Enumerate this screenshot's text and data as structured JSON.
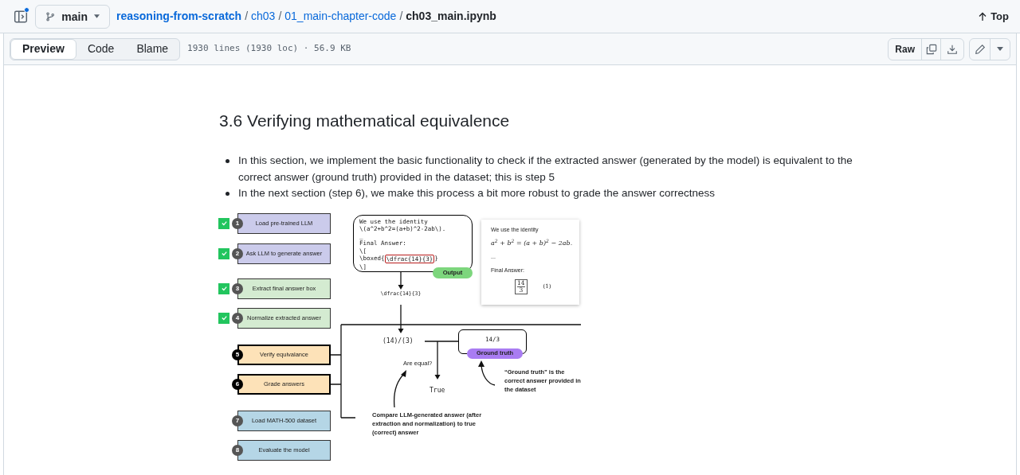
{
  "header": {
    "branch": "main",
    "breadcrumb": [
      {
        "text": "reasoning-from-scratch",
        "kind": "link"
      },
      {
        "text": "ch03",
        "kind": "link"
      },
      {
        "text": "01_main-chapter-code",
        "kind": "link"
      },
      {
        "text": "ch03_main.ipynb",
        "kind": "current"
      }
    ],
    "separator": "/",
    "top_link": "Top"
  },
  "toolbar": {
    "tabs": [
      {
        "label": "Preview",
        "selected": true
      },
      {
        "label": "Code",
        "selected": false
      },
      {
        "label": "Blame",
        "selected": false
      }
    ],
    "file_info": "1930 lines (1930 loc) · 56.9 KB",
    "raw_button": "Raw"
  },
  "notebook": {
    "heading": "3.6 Verifying mathematical equivalence",
    "bullets": [
      "In this section, we implement the basic functionality to check if the extracted answer (generated by the model) is equivalent to the correct answer (ground truth) provided in the dataset; this is step 5",
      "In the next section (step 6), we make this process a bit more robust to grade the answer correctness"
    ],
    "figure": {
      "steps": [
        {
          "number": "1",
          "label": "Load pre-trained LLM",
          "done": true,
          "current": false,
          "color": "#cbcbeb"
        },
        {
          "number": "2",
          "label": "Ask LLM to generate answer",
          "done": true,
          "current": false,
          "color": "#cbcbeb"
        },
        {
          "number": "3",
          "label": "Extract final answer box",
          "done": true,
          "current": false,
          "color": "#d4ebd1"
        },
        {
          "number": "4",
          "label": "Normalize extracted answer",
          "done": true,
          "current": false,
          "color": "#d4ebd1"
        },
        {
          "number": "5",
          "label": "Verify equivalance",
          "done": false,
          "current": true,
          "color": "#fde2b8"
        },
        {
          "number": "6",
          "label": "Grade answers",
          "done": false,
          "current": true,
          "color": "#fde2b8"
        },
        {
          "number": "7",
          "label": "Load MATH-500 dataset",
          "done": false,
          "current": false,
          "color": "#b5d6e6"
        },
        {
          "number": "8",
          "label": "Evaluate the model",
          "done": false,
          "current": false,
          "color": "#b5d6e6"
        }
      ],
      "output_box": {
        "code_lines": [
          "We use the identity",
          "\\(a^2+b^2=(a+b)^2-2ab\\).",
          "_",
          "Final Answer:",
          "\\["
        ],
        "boxed_line": {
          "prefix": "\\boxed{",
          "highlight": "\\dfrac{14}{3}",
          "suffix": "}"
        },
        "last_line": "\\]",
        "tag": "Output"
      },
      "rendered": {
        "intro": "We use the identity",
        "formula": "a$^{2}$ + b$^{2}$ = (a + b)$^{2}$ − 2ab.",
        "ellipsis": "...",
        "final_label": "Final Answer:",
        "numerator": "14",
        "denominator": "3",
        "equation_number": "(1)"
      },
      "extracted": "\\dfrac{14}{3}",
      "normalized": "(14)/(3)",
      "question": "Are equal?",
      "result": "True",
      "ground_truth": {
        "value": "14/3",
        "tag": "Ground truth"
      },
      "ground_note": "“Ground truth” is the correct answer provided in the dataset",
      "compare_note": "Compare LLM-generated answer (after extraction and normalization) to true (correct) answer"
    }
  }
}
